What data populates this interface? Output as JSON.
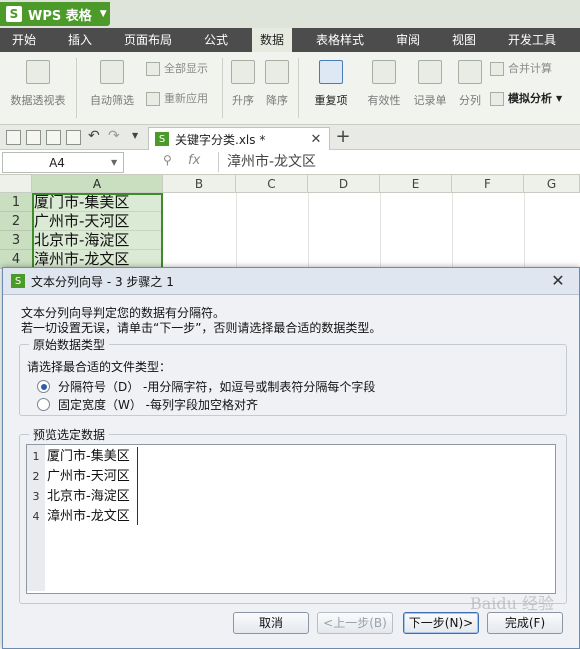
{
  "app": {
    "title": "WPS 表格",
    "logo": "S"
  },
  "menu": [
    "开始",
    "插入",
    "页面布局",
    "公式",
    "数据",
    "表格样式",
    "审阅",
    "视图",
    "开发工具"
  ],
  "menu_active": "数据",
  "ribbon": {
    "pivot": "数据透视表",
    "autofilter": "自动筛选",
    "show_all": "全部显示",
    "reapply": "重新应用",
    "sort_asc": "升序",
    "sort_desc": "降序",
    "duplicates": "重复项",
    "validity": "有效性",
    "record": "记录单",
    "split": "分列",
    "merge_calc": "合并计算",
    "simulate": "模拟分析"
  },
  "document_tab": {
    "filename": "关键字分类.xls *"
  },
  "formula_bar": {
    "cell_ref": "A4",
    "fx": "fx",
    "content": "漳州市-龙文区"
  },
  "sheet": {
    "columns": [
      "A",
      "B",
      "C",
      "D",
      "E",
      "F",
      "G"
    ],
    "rows": [
      {
        "num": "1",
        "value": "厦门市-集美区"
      },
      {
        "num": "2",
        "value": "广州市-天河区"
      },
      {
        "num": "3",
        "value": "北京市-海淀区"
      },
      {
        "num": "4",
        "value": "漳州市-龙文区"
      }
    ]
  },
  "dialog": {
    "title": "文本分列向导 - 3 步骤之 1",
    "intro1": "文本分列向导判定您的数据有分隔符。",
    "intro2": "若一切设置无误，请单击“下一步”，否则请选择最合适的数据类型。",
    "group1_title": "原始数据类型",
    "choose_label": "请选择最合适的文件类型：",
    "option_delimited": "分隔符号（D）  -用分隔字符，如逗号或制表符分隔每个字段",
    "option_fixed": "固定宽度（W）  -每列字段加空格对齐",
    "group2_title": "预览选定数据",
    "preview": [
      {
        "n": "1",
        "text": "厦门市-集美区"
      },
      {
        "n": "2",
        "text": "广州市-天河区"
      },
      {
        "n": "3",
        "text": "北京市-海淀区"
      },
      {
        "n": "4",
        "text": "漳州市-龙文区"
      }
    ],
    "buttons": {
      "cancel": "取消",
      "prev": "<上一步(B)",
      "next": "下一步(N)>",
      "finish": "完成(F)"
    }
  },
  "watermark": "Baidu 经验"
}
